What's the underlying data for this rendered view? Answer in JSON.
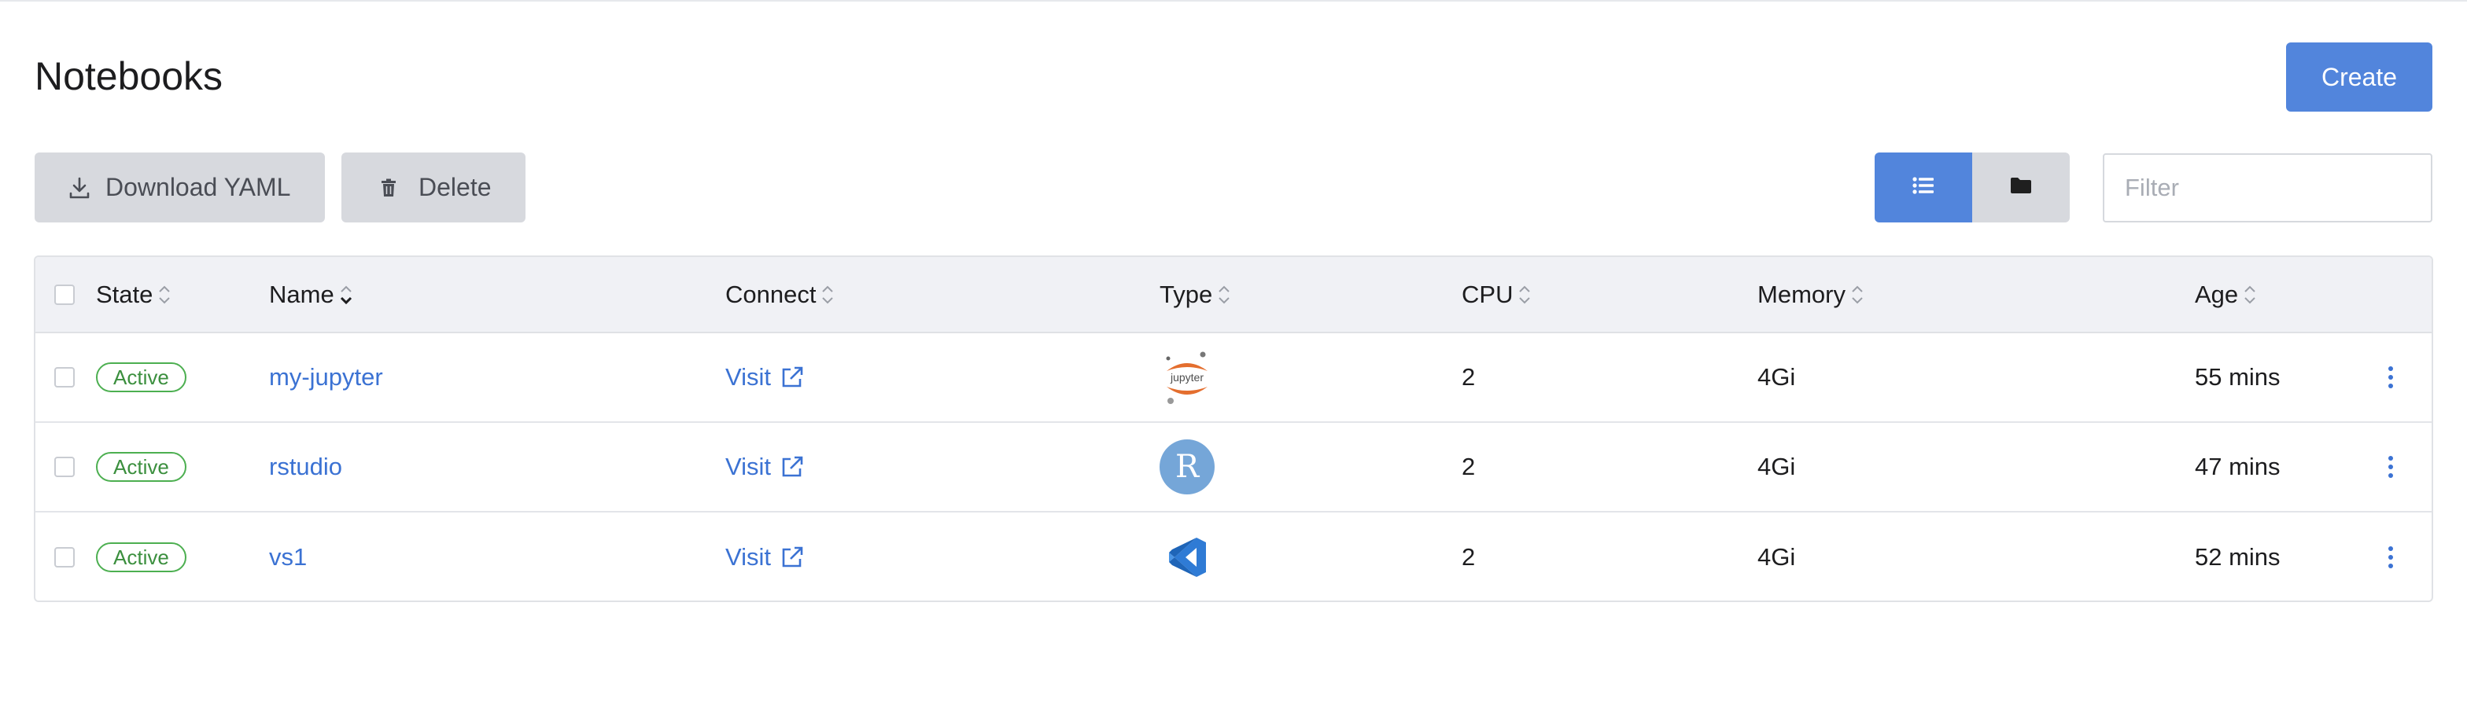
{
  "page": {
    "title": "Notebooks"
  },
  "toolbar": {
    "create_label": "Create",
    "download_label": "Download YAML",
    "delete_label": "Delete",
    "filter_placeholder": "Filter",
    "view_mode": "list"
  },
  "table": {
    "columns": {
      "state": "State",
      "name": "Name",
      "connect": "Connect",
      "type": "Type",
      "cpu": "CPU",
      "memory": "Memory",
      "age": "Age"
    },
    "sorted_column": "name",
    "rows": [
      {
        "selected": false,
        "state": "Active",
        "name": "my-jupyter",
        "connect": "Visit",
        "type": "jupyter-icon",
        "cpu": "2",
        "memory": "4Gi",
        "age": "55 mins"
      },
      {
        "selected": false,
        "state": "Active",
        "name": "rstudio",
        "connect": "Visit",
        "type": "rstudio-icon",
        "cpu": "2",
        "memory": "4Gi",
        "age": "47 mins"
      },
      {
        "selected": false,
        "state": "Active",
        "name": "vs1",
        "connect": "Visit",
        "type": "vscode-icon",
        "cpu": "2",
        "memory": "4Gi",
        "age": "52 mins"
      }
    ]
  },
  "icons": {
    "jupyter_text": "jupyter",
    "rstudio_letter": "R"
  },
  "colors": {
    "primary": "#5285dc",
    "link": "#3b72d3",
    "active": "#4caf50",
    "jupyter_orange": "#e46e2e",
    "vscode_blue": "#2f7bd5"
  }
}
